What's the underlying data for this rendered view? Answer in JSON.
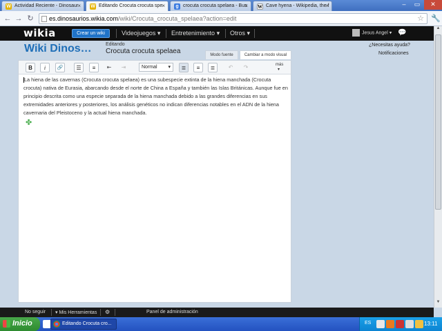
{
  "browser": {
    "tabs": [
      {
        "label": "Actividad Reciente - Dinosaur",
        "favicon": "wikia"
      },
      {
        "label": "Editando Crocuta crocuta spe",
        "favicon": "wikia",
        "active": true
      },
      {
        "label": "crocuta crocuta spelaea - Bus",
        "favicon": "google"
      },
      {
        "label": "Cave hyena - Wikipedia, the f",
        "favicon": "wikipedia"
      }
    ],
    "tab_close": "×",
    "window_controls": {
      "minimize": "–",
      "maximize": "▭",
      "close": "✕"
    },
    "address": {
      "domain": "es.dinosaurios.wikia.com",
      "path": "/wiki/Crocuta_crocuta_spelaea?action=edit"
    },
    "icons": {
      "back": "←",
      "forward": "→",
      "reload": "↻",
      "star": "☆",
      "wrench": "🔧"
    }
  },
  "wikia_nav": {
    "logo": "wikia",
    "create_wiki": "Crear un wiki",
    "links": [
      "Videojuegos",
      "Entretenimiento",
      "Otros"
    ],
    "dropdown_glyph": "▾",
    "user": "Jesus Angel",
    "user_glyph": "▾",
    "messages_icon": "💬"
  },
  "header": {
    "wiki_title": "Wiki Dinos…",
    "editing_label": "Editando",
    "page_name": "Crocuta crocuta spelaea",
    "mode_source": "Modo fuente",
    "mode_visual": "Cambiar a modo visual",
    "help": "¿Necesitas ayuda?",
    "notifications": "Notificaciones"
  },
  "toolbar": {
    "bold": "B",
    "italic": "i",
    "link": "🔗",
    "bullet_list": "☰",
    "numbered_list": "≡",
    "outdent": "⇤",
    "indent": "⇥",
    "format": "Normal",
    "format_arrow": "▾",
    "align_left": "≣",
    "align_center": "≡",
    "align_right": "≣",
    "undo": "↶",
    "redo": "↷",
    "more": "más",
    "more_arrow": "▾"
  },
  "editor_text": "La hiena de las cavernas (Crocuta crocuta spelaea) es una subespecie extinta de la hiena manchada (Crocuta crocuta) nativa de Eurasia, abarcando desde el norte de China a España y también las Islas Británicas. Aunque fue en principio descrita como una especie separada de la hiena manchada debido a las grandes diferencias en sus extremidades anteriores y posteriores, los análisis genéticos no indican diferencias notables en el ADN de la hiena cavernaria del Pleistoceno y la actual hiena manchada.",
  "editor_plugin_icon": "✤",
  "scrollbar": {
    "up": "▲",
    "down": "▼"
  },
  "bottom_bar": {
    "unfollow": "No seguir",
    "my_tools": "Mis Herramientas",
    "my_tools_glyph": "▾",
    "gear": "⚙",
    "admin_panel": "Panel de administración"
  },
  "taskbar": {
    "start": "Inicio",
    "window": "Editando Crocuta cro...",
    "language": "ES",
    "clock": "13:11"
  }
}
